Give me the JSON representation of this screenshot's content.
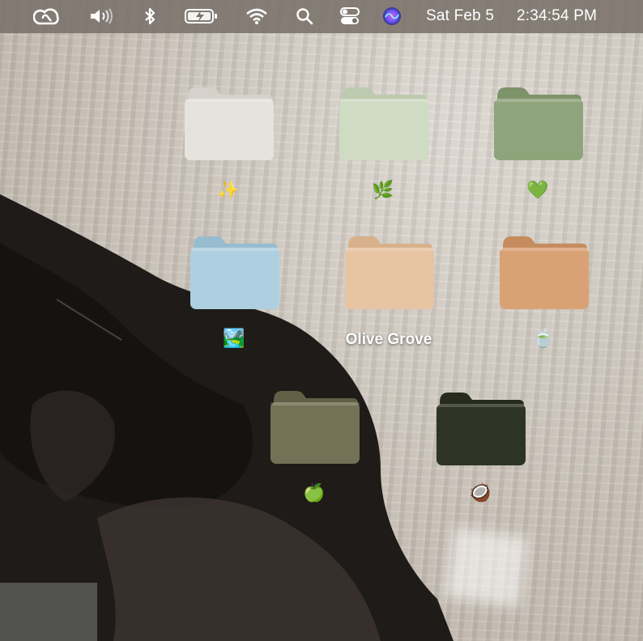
{
  "menubar": {
    "icons": [
      "creative-cloud-icon",
      "volume-icon",
      "bluetooth-icon",
      "battery-charging-icon",
      "wifi-icon",
      "search-icon",
      "control-center-icon",
      "siri-icon"
    ],
    "date": "Sat Feb 5",
    "time": "2:34:54 PM"
  },
  "desktop": {
    "folders": [
      {
        "label": "✨",
        "color": "#e6e2dc",
        "tab": "#d6d2cb"
      },
      {
        "label": "🌿",
        "color": "#cfdbc2",
        "tab": "#bccbae"
      },
      {
        "label": "💚",
        "color": "#8ea47a",
        "tab": "#7d9369"
      },
      {
        "label": "🏞️",
        "color": "#aecfe0",
        "tab": "#97bcd0"
      },
      {
        "label": "Olive Grove",
        "color": "#e7c4a2",
        "tab": "#d8b18c"
      },
      {
        "label": "🍵",
        "color": "#d9a274",
        "tab": "#c58d5f"
      },
      {
        "label": "🍏",
        "color": "#737256",
        "tab": "#616046"
      },
      {
        "label": "🥥",
        "color": "#2e3424",
        "tab": "#262b1d"
      }
    ]
  }
}
